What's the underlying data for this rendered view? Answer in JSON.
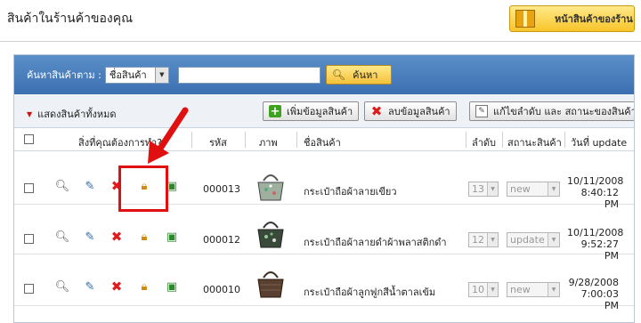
{
  "page": {
    "title": "สินค้าในร้านค้าของคุณ",
    "shop_button_label": "หน้าสินค้าของร้าน"
  },
  "search": {
    "label": "ค้นหาสินค้าตาม :",
    "field_option": "ชื่อสินค้า",
    "query": "",
    "button_label": "ค้นหา"
  },
  "actions": {
    "show_all_label": "แสดงสินค้าทั้งหมด",
    "add_label": "เพิ่มข้อมูลสินค้า",
    "delete_label": "ลบข้อมูลสินค้า",
    "reorder_label": "แก้ไขลำดับ และ สถานะของสินค้า"
  },
  "table": {
    "headers": {
      "actions": "สิ่งที่คุณต้องการทำ?",
      "code": "รหัส",
      "image": "ภาพ",
      "name": "ชื่อสินค้า",
      "order": "ลำดับ",
      "status": "สถานะสินค้า",
      "updated": "วันที่ update"
    },
    "rows": [
      {
        "code": "000013",
        "name": "กระเป๋าถือผ้าลายเขียว",
        "order": "13",
        "status": "new",
        "date": "10/11/2008",
        "time": "8:40:12 PM"
      },
      {
        "code": "000012",
        "name": "กระเป๋าถือผ้าลายดำผ้าพลาสติกดำ",
        "order": "12",
        "status": "update",
        "date": "10/11/2008",
        "time": "9:52:27 PM"
      },
      {
        "code": "000010",
        "name": "กระเป๋าถือผ้าลูกฟูกสีน้ำตาลเข้ม",
        "order": "10",
        "status": "new",
        "date": "9/28/2008",
        "time": "7:00:03 PM"
      }
    ]
  },
  "colors": {
    "search_bar": "#3b6fb0",
    "accent_yellow": "#f8c52a",
    "annotation_red": "#e01010"
  },
  "icons": [
    "search-icon",
    "edit-icon",
    "delete-icon",
    "lock-icon",
    "image-add-icon",
    "add-icon",
    "doc-edit-icon",
    "box-icon",
    "arrow-annotation"
  ]
}
